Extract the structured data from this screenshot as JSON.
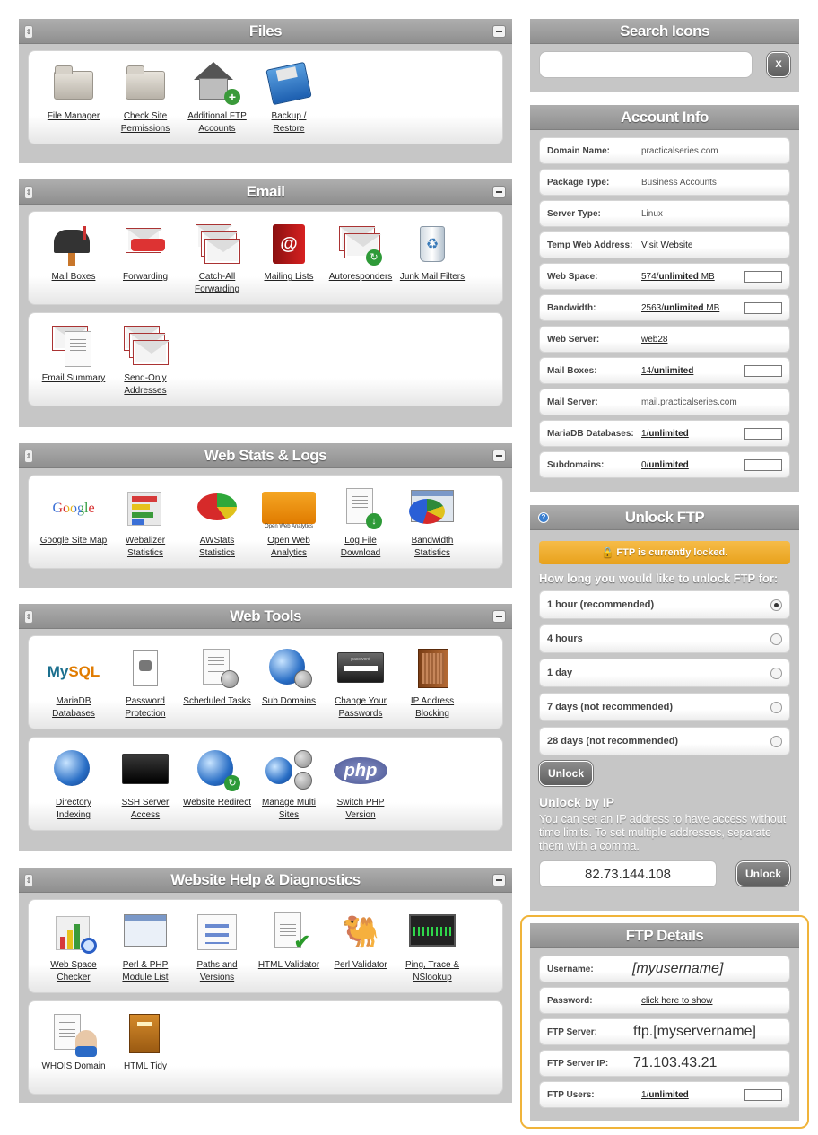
{
  "files": {
    "title": "Files",
    "items": [
      {
        "label": "File Manager",
        "icon": "folder-icon"
      },
      {
        "label": "Check Site Permissions",
        "icon": "folder-icon"
      },
      {
        "label": "Additional FTP Accounts",
        "icon": "add-user-house-icon"
      },
      {
        "label": "Backup / Restore",
        "icon": "floppy-disk-icon"
      }
    ]
  },
  "email": {
    "title": "Email",
    "row1": [
      {
        "label": "Mail Boxes",
        "icon": "mailbox-icon"
      },
      {
        "label": "Forwarding",
        "icon": "forward-envelope-icon"
      },
      {
        "label": "Catch-All Forwarding",
        "icon": "envelopes-icon"
      },
      {
        "label": "Mailing Lists",
        "icon": "address-book-icon"
      },
      {
        "label": "Autoresponders",
        "icon": "auto-envelope-icon"
      },
      {
        "label": "Junk Mail Filters",
        "icon": "recycle-bin-icon"
      }
    ],
    "row2": [
      {
        "label": "Email Summary",
        "icon": "clipboard-envelope-icon"
      },
      {
        "label": "Send-Only Addresses",
        "icon": "envelopes-icon"
      }
    ]
  },
  "webstats": {
    "title": "Web Stats & Logs",
    "items": [
      {
        "label": "Google Site Map",
        "icon": "google-logo-icon"
      },
      {
        "label": "Webalizer Statistics",
        "icon": "bar-chart-icon"
      },
      {
        "label": "AWStats Statistics",
        "icon": "pie-chart-icon"
      },
      {
        "label": "Open Web Analytics",
        "icon": "open-web-analytics-icon"
      },
      {
        "label": "Log File Download",
        "icon": "log-download-icon"
      },
      {
        "label": "Bandwidth Statistics",
        "icon": "pie-chart-window-icon"
      }
    ],
    "owa_caption": "Open Web Analytics",
    "google_text": "Google"
  },
  "webtools": {
    "title": "Web Tools",
    "row1": [
      {
        "label": "MariaDB Databases",
        "icon": "mysql-logo-icon"
      },
      {
        "label": "Password Protection",
        "icon": "padlock-icon"
      },
      {
        "label": "Scheduled Tasks",
        "icon": "clock-document-icon"
      },
      {
        "label": "Sub Domains",
        "icon": "globe-network-icon"
      },
      {
        "label": "Change Your Passwords",
        "icon": "password-window-icon"
      },
      {
        "label": "IP Address Blocking",
        "icon": "brick-wall-icon"
      }
    ],
    "row2": [
      {
        "label": "Directory Indexing",
        "icon": "globe-pen-icon"
      },
      {
        "label": "SSH Server Access",
        "icon": "terminal-icon"
      },
      {
        "label": "Website Redirect",
        "icon": "globe-redirect-icon"
      },
      {
        "label": "Manage Multi Sites",
        "icon": "multi-globe-icon"
      },
      {
        "label": "Switch PHP Version",
        "icon": "php-logo-icon"
      }
    ],
    "mysql_text_a": "My",
    "mysql_text_b": "SQL",
    "php_text": "php",
    "password_caption": "password"
  },
  "help": {
    "title": "Website Help & Diagnostics",
    "row1": [
      {
        "label": "Web Space Checker",
        "icon": "chart-magnifier-icon"
      },
      {
        "label": "Perl & PHP Module List",
        "icon": "module-list-icon"
      },
      {
        "label": "Paths and Versions",
        "icon": "flowchart-icon"
      },
      {
        "label": "HTML Validator",
        "icon": "checkmark-document-icon"
      },
      {
        "label": "Perl Validator",
        "icon": "camel-icon"
      },
      {
        "label": "Ping, Trace & NSlookup",
        "icon": "monitor-graph-icon"
      }
    ],
    "row2": [
      {
        "label": "WHOIS Domain",
        "icon": "whois-person-icon"
      },
      {
        "label": "HTML Tidy",
        "icon": "filing-cabinet-icon"
      }
    ]
  },
  "search": {
    "title": "Search Icons",
    "placeholder": "",
    "clear_label": "X"
  },
  "account": {
    "title": "Account Info",
    "rows": [
      {
        "label": "Domain Name:",
        "value": "practicalseries.com"
      },
      {
        "label": "Package Type:",
        "value": "Business Accounts"
      },
      {
        "label": "Server Type:",
        "value": "Linux"
      },
      {
        "label": "Temp Web Address:",
        "value": "Visit Website"
      },
      {
        "label": "Web Space:",
        "value_a": "574/",
        "value_b": "unlimited",
        "value_c": " MB",
        "usage": 0
      },
      {
        "label": "Bandwidth:",
        "value_a": "2563/",
        "value_b": "unlimited",
        "value_c": " MB",
        "usage": 0
      },
      {
        "label": "Web Server:",
        "value": "web28"
      },
      {
        "label": "Mail Boxes:",
        "value_a": "14/",
        "value_b": "unlimited",
        "value_c": "",
        "usage": 0
      },
      {
        "label": "Mail Server:",
        "value": "mail.practicalseries.com"
      },
      {
        "label": "MariaDB Databases:",
        "value_a": "1/",
        "value_b": "unlimited",
        "value_c": "",
        "usage": 0
      },
      {
        "label": "Subdomains:",
        "value_a": "0/",
        "value_b": "unlimited",
        "value_c": "",
        "usage": 0
      }
    ]
  },
  "unlock": {
    "title": "Unlock FTP",
    "help_glyph": "?",
    "banner": "🔒 FTP is currently locked.",
    "question": "How long you would like to unlock FTP for:",
    "options": [
      {
        "label": "1 hour (recommended)",
        "selected": true
      },
      {
        "label": "4 hours",
        "selected": false
      },
      {
        "label": "1 day",
        "selected": false
      },
      {
        "label": "7 days (not recommended)",
        "selected": false
      },
      {
        "label": "28 days (not recommended)",
        "selected": false
      }
    ],
    "unlock_label": "Unlock",
    "by_ip_title": "Unlock by IP",
    "by_ip_text": "You can set an IP address to have access without time limits. To set multiple addresses, separate them with a comma.",
    "ip_value": "82.73.144.108",
    "ip_unlock_label": "Unlock"
  },
  "ftp": {
    "title": "FTP Details",
    "username_label": "Username:",
    "username_value": "[myusername]",
    "password_label": "Password:",
    "password_value": "click here to show",
    "server_label": "FTP Server:",
    "server_value": "ftp.[myservername]",
    "server_ip_label": "FTP Server IP:",
    "server_ip_value": "71.103.43.21",
    "users_label": "FTP Users:",
    "users_value_a": "1/",
    "users_value_b": "unlimited",
    "users_usage": 0
  },
  "colors": {
    "panel_bg": "#c6c6c6",
    "header_bg": "#9c9c9c",
    "locked_banner": "#eeaa2a",
    "highlight_border": "#f0b43a"
  }
}
